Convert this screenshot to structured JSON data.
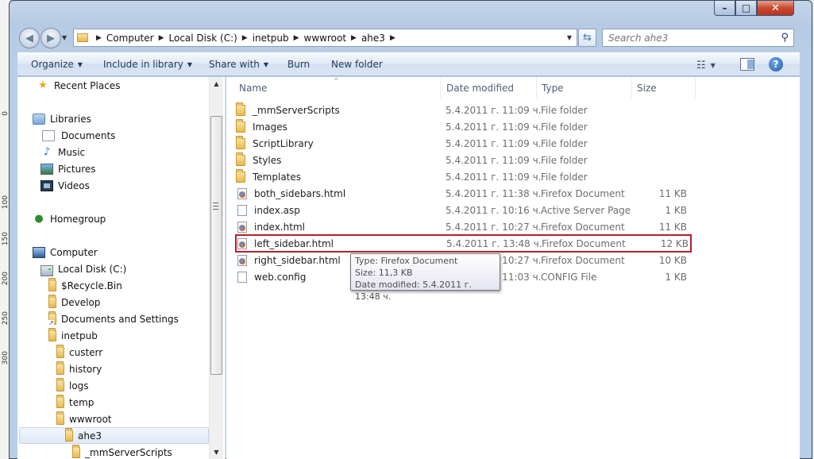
{
  "ruler": {
    "marks": [
      "0",
      "100",
      "150",
      "200",
      "250",
      "300"
    ]
  },
  "window": {
    "title_ghost": "",
    "caption": {
      "minimize": "–",
      "maximize": "□",
      "close": "✕"
    }
  },
  "nav": {
    "back_icon": "back-arrow-icon",
    "forward_icon": "forward-arrow-icon",
    "breadcrumbs": [
      "Computer",
      "Local Disk (C:)",
      "inetpub",
      "wwwroot",
      "ahe3"
    ],
    "search_placeholder": "Search ahe3"
  },
  "toolbar": {
    "organize": "Organize",
    "include": "Include in library",
    "share": "Share with",
    "burn": "Burn",
    "new_folder": "New folder"
  },
  "sidebar": {
    "items": [
      {
        "label": "Recent Places",
        "icon": "recent-places-icon"
      },
      {
        "label": "Libraries",
        "icon": "libraries-icon"
      },
      {
        "label": "Documents",
        "icon": "documents-library-icon"
      },
      {
        "label": "Music",
        "icon": "music-library-icon"
      },
      {
        "label": "Pictures",
        "icon": "pictures-library-icon"
      },
      {
        "label": "Videos",
        "icon": "videos-library-icon"
      },
      {
        "label": "Homegroup",
        "icon": "homegroup-icon"
      },
      {
        "label": "Computer",
        "icon": "computer-icon"
      },
      {
        "label": "Local Disk (C:)",
        "icon": "local-disk-icon"
      },
      {
        "label": "$Recycle.Bin",
        "icon": "folder-icon"
      },
      {
        "label": "Develop",
        "icon": "folder-icon"
      },
      {
        "label": "Documents and Settings",
        "icon": "folder-shortcut-icon"
      },
      {
        "label": "inetpub",
        "icon": "folder-icon"
      },
      {
        "label": "custerr",
        "icon": "folder-icon"
      },
      {
        "label": "history",
        "icon": "folder-icon"
      },
      {
        "label": "logs",
        "icon": "folder-icon"
      },
      {
        "label": "temp",
        "icon": "folder-icon"
      },
      {
        "label": "wwwroot",
        "icon": "folder-icon"
      },
      {
        "label": "ahe3",
        "icon": "folder-icon"
      },
      {
        "label": "_mmServerScripts",
        "icon": "folder-icon"
      }
    ]
  },
  "columns": {
    "name": "Name",
    "date": "Date modified",
    "type": "Type",
    "size": "Size"
  },
  "files": [
    {
      "name": "_mmServerScripts",
      "date": "5.4.2011 г. 11:09 ч.",
      "type": "File folder",
      "size": "",
      "icon": "folder-icon"
    },
    {
      "name": "Images",
      "date": "5.4.2011 г. 11:09 ч.",
      "type": "File folder",
      "size": "",
      "icon": "folder-icon"
    },
    {
      "name": "ScriptLibrary",
      "date": "5.4.2011 г. 11:09 ч.",
      "type": "File folder",
      "size": "",
      "icon": "folder-icon"
    },
    {
      "name": "Styles",
      "date": "5.4.2011 г. 11:09 ч.",
      "type": "File folder",
      "size": "",
      "icon": "folder-icon"
    },
    {
      "name": "Templates",
      "date": "5.4.2011 г. 11:09 ч.",
      "type": "File folder",
      "size": "",
      "icon": "folder-icon"
    },
    {
      "name": "both_sidebars.html",
      "date": "5.4.2011 г. 11:38 ч.",
      "type": "Firefox Document",
      "size": "11 KB",
      "icon": "firefox-document-icon"
    },
    {
      "name": "index.asp",
      "date": "5.4.2011 г. 10:16 ч.",
      "type": "Active Server Page",
      "size": "1 KB",
      "icon": "document-icon"
    },
    {
      "name": "index.html",
      "date": "5.4.2011 г. 10:27 ч.",
      "type": "Firefox Document",
      "size": "11 KB",
      "icon": "firefox-document-icon"
    },
    {
      "name": "left_sidebar.html",
      "date": "5.4.2011 г. 13:48 ч.",
      "type": "Firefox Document",
      "size": "12 KB",
      "icon": "firefox-document-icon"
    },
    {
      "name": "right_sidebar.html",
      "date": "5.4.2011 г. 10:27 ч.",
      "type": "Firefox Document",
      "size": "10 KB",
      "icon": "firefox-document-icon"
    },
    {
      "name": "web.config",
      "date": "5.4.2011 г. 11:03 ч.",
      "type": "CONFIG File",
      "size": "1 KB",
      "icon": "document-icon"
    }
  ],
  "tooltip": {
    "type": "Type: Firefox Document",
    "size": "Size: 11,3 KB",
    "date": "Date modified: 5.4.2011 г. 13:48 ч."
  },
  "colors": {
    "highlight_border": "#b91e2c",
    "toolbar_text": "#1e395b"
  }
}
